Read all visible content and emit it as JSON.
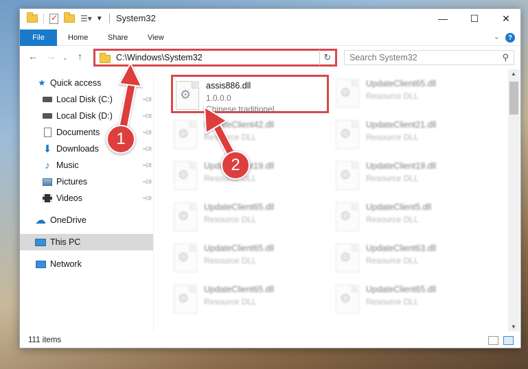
{
  "window": {
    "title": "System32",
    "controls": {
      "minimize": "—",
      "maximize": "☐",
      "close": "✕"
    }
  },
  "ribbon": {
    "tabs": [
      "File",
      "Home",
      "Share",
      "View"
    ],
    "help": "?"
  },
  "address_bar": {
    "path": "C:\\Windows\\System32"
  },
  "search": {
    "placeholder": "Search System32"
  },
  "sidebar": {
    "items": [
      {
        "label": "Quick access",
        "icon": "star-icon",
        "pinned": false
      },
      {
        "label": "Local Disk (C:)",
        "icon": "drive-icon",
        "pinned": true
      },
      {
        "label": "Local Disk (D:)",
        "icon": "drive-icon",
        "pinned": true
      },
      {
        "label": "Documents",
        "icon": "documents-icon",
        "pinned": true
      },
      {
        "label": "Downloads",
        "icon": "download-icon",
        "pinned": true
      },
      {
        "label": "Music",
        "icon": "music-icon",
        "pinned": true
      },
      {
        "label": "Pictures",
        "icon": "pictures-icon",
        "pinned": true
      },
      {
        "label": "Videos",
        "icon": "videos-icon",
        "pinned": true
      },
      {
        "label": "OneDrive",
        "icon": "cloud-icon",
        "pinned": false
      },
      {
        "label": "This PC",
        "icon": "computer-icon",
        "pinned": false,
        "selected": true
      },
      {
        "label": "Network",
        "icon": "network-icon",
        "pinned": false
      }
    ]
  },
  "files": [
    {
      "name": "assis886.dll",
      "line2": "1.0.0.0",
      "line3": "Chinese traditionel...",
      "highlighted": true
    },
    {
      "name": "UpdateClient65.dll",
      "line2": "Resource DLL",
      "line3": ""
    },
    {
      "name": "UpdateClient42.dll",
      "line2": "Resource DLL",
      "line3": ""
    },
    {
      "name": "UpdateClient21.dll",
      "line2": "Resource DLL",
      "line3": ""
    },
    {
      "name": "UpdateClient19.dll",
      "line2": "Resource DLL",
      "line3": ""
    },
    {
      "name": "UpdateClient19.dll",
      "line2": "Resource DLL",
      "line3": ""
    },
    {
      "name": "UpdateClient65.dll",
      "line2": "Resource DLL",
      "line3": ""
    },
    {
      "name": "UpdateClient5.dll",
      "line2": "Resource DLL",
      "line3": ""
    },
    {
      "name": "UpdateClient65.dll",
      "line2": "Resource DLL",
      "line3": ""
    },
    {
      "name": "UpdateClient63.dll",
      "line2": "Resource DLL",
      "line3": ""
    },
    {
      "name": "UpdateClient65.dll",
      "line2": "Resource DLL",
      "line3": ""
    },
    {
      "name": "UpdateClient65.dll",
      "line2": "Resource DLL",
      "line3": ""
    }
  ],
  "status": {
    "item_count": "111 items"
  },
  "callouts": [
    {
      "number": "1"
    },
    {
      "number": "2"
    }
  ],
  "colors": {
    "accent": "#1979ca",
    "highlight": "#d8474b",
    "badge": "#dd3e3e"
  }
}
